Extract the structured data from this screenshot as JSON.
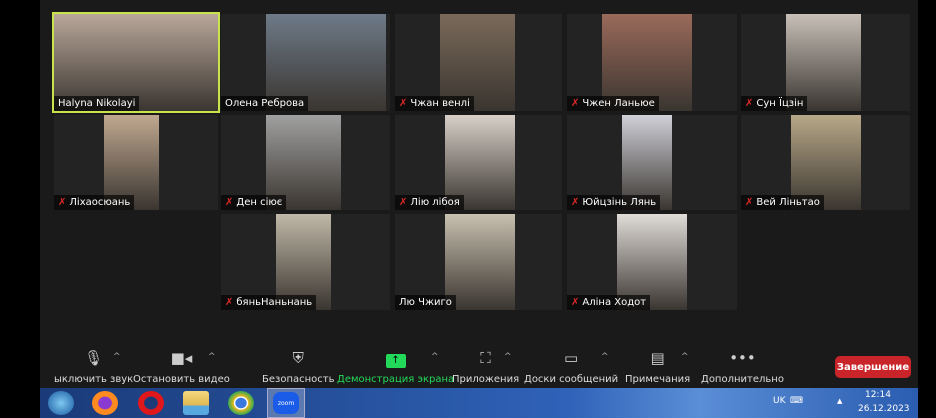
{
  "participants": [
    {
      "name": "Halyna Nikolayi",
      "muted": false,
      "active": true
    },
    {
      "name": "Олена Реброва",
      "muted": false
    },
    {
      "name": "Чжан венлі",
      "muted": true
    },
    {
      "name": "Чжен Ланьюе",
      "muted": true
    },
    {
      "name": "Сун Їцзін",
      "muted": true
    },
    {
      "name": "Ліхаосюань",
      "muted": true
    },
    {
      "name": "Ден сіює",
      "muted": true
    },
    {
      "name": "Лію лібоя",
      "muted": true
    },
    {
      "name": "Юйцзінь Лянь",
      "muted": true
    },
    {
      "name": "Вей Ліньтао",
      "muted": true
    },
    {
      "name": "бяньНаньнань",
      "muted": true
    },
    {
      "name": "Лю Чжиго",
      "muted": false
    },
    {
      "name": "Аліна Ходот",
      "muted": true
    }
  ],
  "toolbar": {
    "mute": "ыключить звук",
    "video": "Остановить видео",
    "security": "Безопасность",
    "share": "Демонстрация экрана",
    "apps": "Приложения",
    "whiteboards": "Доски сообщений",
    "notes": "Примечания",
    "more": "Дополнительно",
    "end": "Завершение"
  },
  "taskbar": {
    "lang": "UK",
    "time": "12:14",
    "date": "26.12.2023",
    "zoom_label": "zoom"
  },
  "colors": {
    "share": "#23d959",
    "end": "#c8242a",
    "active": "#c9e44a"
  }
}
